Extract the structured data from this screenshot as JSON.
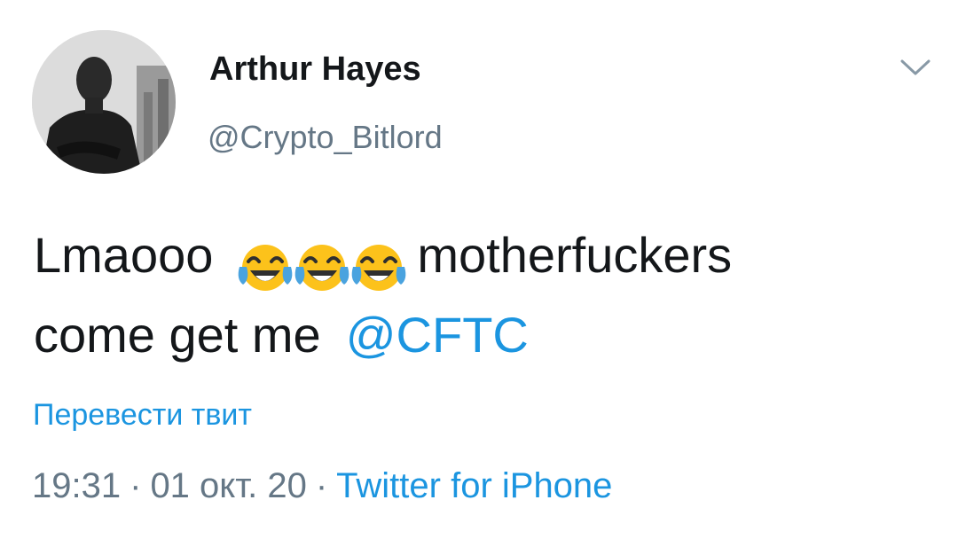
{
  "author": {
    "name": "Arthur Hayes",
    "handle": "@Crypto_Bitlord",
    "avatar_description": "profile-photo"
  },
  "menu": {
    "icon": "chevron-down-icon"
  },
  "tweet": {
    "text_before": "Lmaooo",
    "emoji_name": "face-with-tears-of-joy-emoji",
    "emoji_count": 3,
    "text_after": "motherfuckers",
    "line2_text": "come get me",
    "mention": "@CFTC"
  },
  "translate_label": "Перевести твит",
  "meta": {
    "time": "19:31",
    "separator": "·",
    "date": "01 окт. 20",
    "source": "Twitter for iPhone"
  },
  "colors": {
    "text": "#14171a",
    "secondary": "#657786",
    "link": "#1b95e0",
    "background": "#ffffff"
  }
}
